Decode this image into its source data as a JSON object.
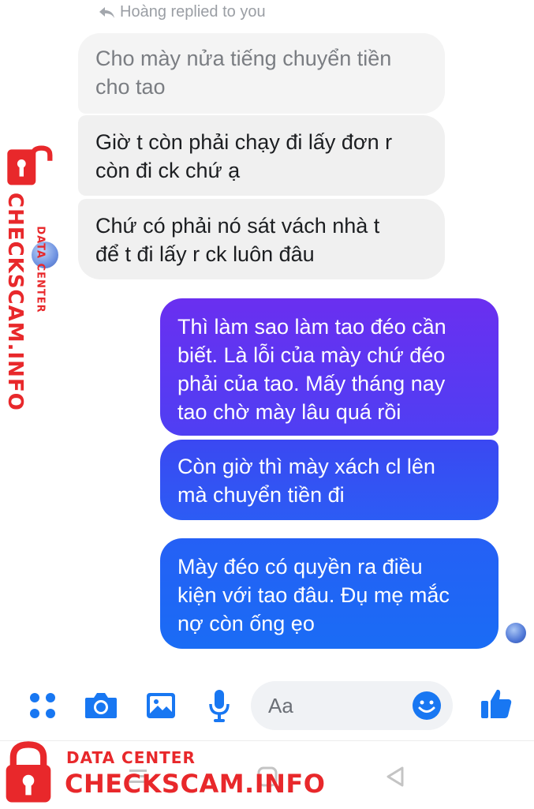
{
  "reply_header": {
    "text": "Hoàng replied to you",
    "icon": "reply-arrow-icon"
  },
  "messages": [
    {
      "direction": "incoming",
      "faded": true,
      "lines": [
        "Cho mày nửa tiếng chuyển tiền",
        "cho tao"
      ]
    },
    {
      "direction": "incoming",
      "faded": false,
      "lines": [
        "Giờ t còn phải chạy đi lấy đơn r",
        "còn đi ck chứ ạ"
      ]
    },
    {
      "direction": "incoming",
      "faded": false,
      "lines": [
        "Chứ có phải nó sát vách nhà t",
        "để t đi lấy r ck luôn đâu"
      ]
    },
    {
      "direction": "outgoing",
      "lines": [
        "Thì làm sao làm tao đéo cần",
        "biết. Là lỗi của mày chứ đéo",
        "phải của tao. Mấy tháng nay",
        "tao chờ mày lâu quá rồi"
      ]
    },
    {
      "direction": "outgoing",
      "lines": [
        "Còn giờ thì mày xách cl lên",
        "mà chuyển tiền đi"
      ]
    },
    {
      "direction": "outgoing",
      "lines": [
        "Mày đéo có quyền ra điều",
        "kiện với tao đâu. Đụ mẹ mắc",
        "nợ còn ống ẹo"
      ]
    }
  ],
  "composer": {
    "placeholder": "Aa",
    "icons": [
      "menu-dots-icon",
      "camera-icon",
      "gallery-icon",
      "microphone-icon",
      "emoji-icon",
      "thumbs-up-icon"
    ]
  },
  "watermark": {
    "top_line": "DATA CENTER",
    "brand": "CHECKSCAM.INFO",
    "icon": "padlock-icon"
  },
  "colors": {
    "incoming_bubble": "#f0f0f0",
    "outgoing_gradient_top": "#6a2ff0",
    "outgoing_gradient_bottom": "#1a6cf5",
    "accent": "#1877f2",
    "watermark_red": "#e8282b"
  },
  "navbar": {
    "icons": [
      "recents-icon",
      "home-icon",
      "back-icon"
    ]
  }
}
